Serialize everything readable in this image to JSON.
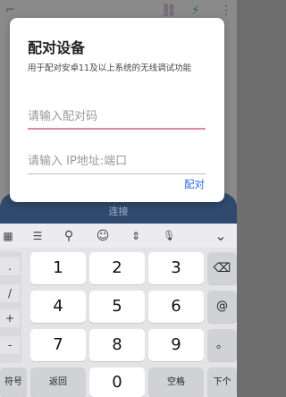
{
  "app": {
    "link_icon": "link-icon",
    "lightning_icon": "lightning-icon",
    "menu_icon": "more-vertical-icon",
    "bottom_button_label": "连接"
  },
  "dialog": {
    "title": "配对设备",
    "description": "用于配对安卓11及以上系统的无线调试功能",
    "pairing_code_placeholder": "请输入配对码",
    "address_placeholder": "请输入 IP地址:端口",
    "pair_button_label": "配对",
    "accent_color": "#2d6cdf"
  },
  "keyboard": {
    "toolbar": {
      "grid": "▦",
      "keyboard": "☰",
      "search": "⚲",
      "emoji": "☺",
      "cursor": "⇕",
      "mic": "🎙",
      "hide": "⌄"
    },
    "symbols": [
      ".",
      "/",
      "+",
      "-"
    ],
    "digits": [
      "1",
      "2",
      "3",
      "4",
      "5",
      "6",
      "7",
      "8",
      "9",
      "0"
    ],
    "backspace": "⌫",
    "at_key": "@",
    "dot_key": "。",
    "bottom_row": {
      "symbols_label": "符号",
      "back_label": "返回",
      "space_label": "空格",
      "next_label": "下个"
    }
  }
}
